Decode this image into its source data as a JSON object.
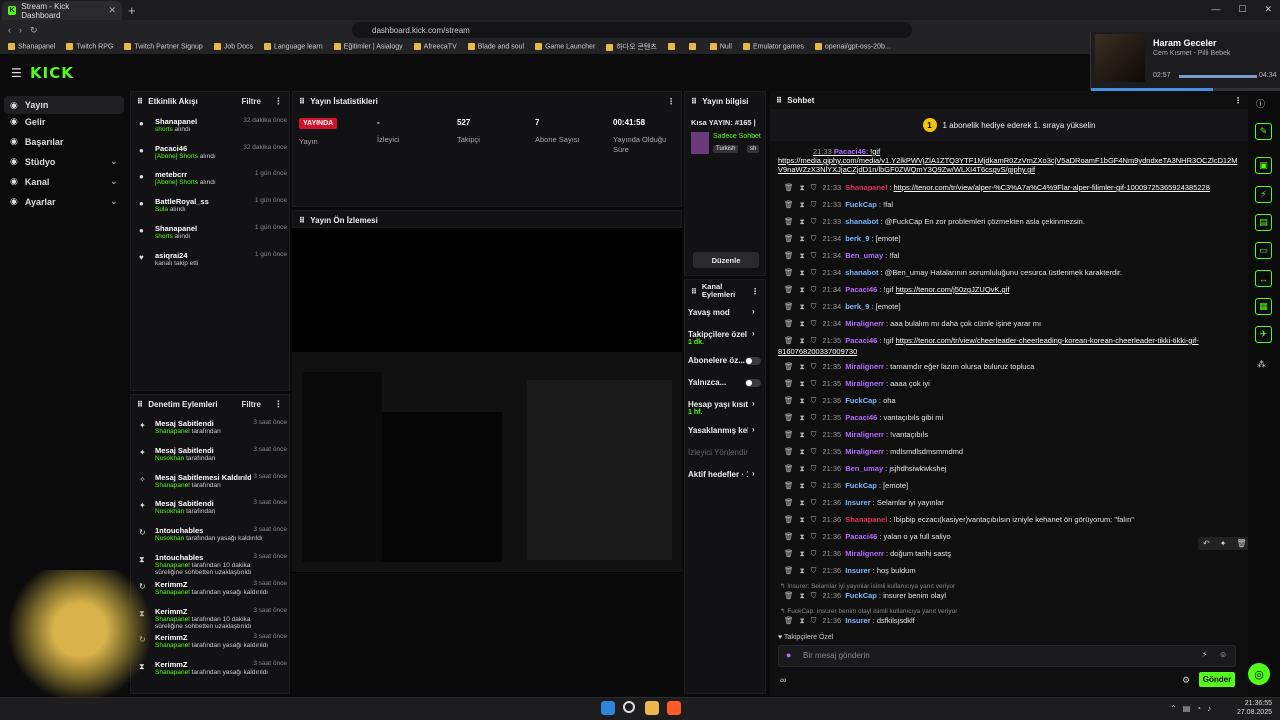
{
  "browser": {
    "tab_title": "Stream - Kick Dashboard",
    "url": "dashboard.kick.com/stream",
    "bookmarks": [
      "Shanapanel",
      "Twitch RPG",
      "Twitch Partner Signup",
      "Job Docs",
      "Language learn",
      "Eğitimler | Asialogy",
      "AfreecaTV",
      "Blade and soul",
      "Game Launcher",
      "하다오 콘텐츠",
      "",
      "",
      "Null",
      "Emulator games",
      "openai/gpt-oss-20b..."
    ]
  },
  "media": {
    "song": "Haram Geceler",
    "artist": "Cem Kısmet - Pilli Bebek",
    "elapsed": "02:57",
    "total": "04:34",
    "progress": 0.64
  },
  "logo": "KICK",
  "nav": [
    {
      "label": "Yayın",
      "active": true,
      "chevron": false
    },
    {
      "label": "Gelir",
      "chevron": false
    },
    {
      "label": "Başarılar",
      "chevron": false
    },
    {
      "label": "Stüdyo",
      "chevron": true
    },
    {
      "label": "Kanal",
      "chevron": true
    },
    {
      "label": "Ayarlar",
      "chevron": true
    }
  ],
  "activity": {
    "title": "Etkinlik Akışı",
    "filter": "Filtre",
    "items": [
      {
        "name": "Shanapanel",
        "sub": "shorts",
        "subtail": "alındı",
        "time": "32 dakika önce",
        "icon": "●"
      },
      {
        "name": "Pacaci46",
        "sub": "[Abone] Shorts",
        "subtail": "alındı",
        "time": "32 dakika önce",
        "icon": "●"
      },
      {
        "name": "metebcrr",
        "sub": "[Abone] Shorts",
        "subtail": "alındı",
        "time": "1 gün önce",
        "icon": "●"
      },
      {
        "name": "BattleRoyal_ss",
        "sub": "Sula",
        "subtail": "alındı",
        "time": "1 gün önce",
        "icon": "●"
      },
      {
        "name": "Shanapanel",
        "sub": "shorts",
        "subtail": "alındı",
        "time": "1 gün önce",
        "icon": "●"
      },
      {
        "name": "asiqrai24",
        "sub": "",
        "subtail": "kanalı takip etti",
        "time": "1 gün önce",
        "icon": "♥"
      }
    ]
  },
  "mod": {
    "title": "Denetim Eylemleri",
    "filter": "Filtre",
    "items": [
      {
        "name": "Mesaj Sabitlendi",
        "by": "Shanapanel",
        "tail": "tarafından",
        "time": "3 saat önce",
        "icon": "✦"
      },
      {
        "name": "Mesaj Sabitlendi",
        "by": "Nusokhan",
        "tail": "tarafından",
        "time": "3 saat önce",
        "icon": "✦"
      },
      {
        "name": "Mesaj Sabitlemesi Kaldırıldı",
        "by": "Shanapanel",
        "tail": "tarafından",
        "time": "3 saat önce",
        "icon": "✧"
      },
      {
        "name": "Mesaj Sabitlendi",
        "by": "Nusokhan",
        "tail": "tarafından",
        "time": "3 saat önce",
        "icon": "✦"
      },
      {
        "name": "1ntouchables",
        "by": "Nusokhan",
        "tail": "tarafından yasağı kaldırıldı",
        "time": "3 saat önce",
        "icon": "↻"
      },
      {
        "name": "1ntouchables",
        "by": "Shanapanel",
        "tail": "tarafından 10 dakika süreliğine sohbetten uzaklaştırıldı",
        "time": "3 saat önce",
        "icon": "⧗"
      },
      {
        "name": "KerimmZ",
        "by": "Shanapanel",
        "tail": "tarafından yasağı kaldırıldı",
        "time": "3 saat önce",
        "icon": "↻"
      },
      {
        "name": "KerimmZ",
        "by": "Shanapanel",
        "tail": "tarafından 10 dakika süreliğine sohbetten uzaklaştırıldı",
        "time": "3 saat önce",
        "icon": "⧗"
      },
      {
        "name": "KerimmZ",
        "by": "Shanapanel",
        "tail": "tarafından yasağı kaldırıldı",
        "time": "3 saat önce",
        "icon": "↻"
      },
      {
        "name": "KerimmZ",
        "by": "Shanapanel",
        "tail": "tarafından yasağı kaldırıldı",
        "time": "3 saat önce",
        "icon": "⧗"
      }
    ]
  },
  "stats": {
    "title": "Yayın İstatistikleri",
    "live": "YAYINDA",
    "live_label": "Yayın",
    "viewers": "-",
    "viewers_label": "İzleyici",
    "followers": "527",
    "followers_label": "Takipçi",
    "subs": "7",
    "subs_label": "Abone Sayısı",
    "uptime": "00:41:58",
    "uptime_label": "Yayında Olduğu Süre"
  },
  "preview": {
    "title": "Yayın Ön İzlemesi"
  },
  "info": {
    "title": "Yayın bilgisi",
    "stream_title": "Kısa YAYIN: #165 |",
    "category": "Sadece Sohbet",
    "tags": [
      "Turkish",
      "sh"
    ],
    "edit": "Düzenle"
  },
  "actions": {
    "title": "Kanal Eylemleri",
    "items": [
      {
        "label": "Yavaş mod",
        "sub": "",
        "ctl": "›"
      },
      {
        "label": "Takipçilere özel so",
        "sub": "1 dk.",
        "ctl": "›"
      },
      {
        "label": "Abonelere öz...",
        "sub": "",
        "ctl": "toggle"
      },
      {
        "label": "Yalnızca...",
        "sub": "",
        "ctl": "toggle"
      },
      {
        "label": "Hesap yaşı kısıtlar",
        "sub": "1 hf.",
        "ctl": "›"
      },
      {
        "label": "Yasaklanmış kelim",
        "sub": "",
        "ctl": "›"
      },
      {
        "label": "İzleyici Yönlendir",
        "sub": "",
        "ctl": ""
      },
      {
        "label": "Aktif hedefler · 1",
        "sub": "",
        "ctl": "›"
      }
    ]
  },
  "chat": {
    "title": "Sohbet",
    "pinned": "1 abonelik hediye ederek 1. sıraya yükselin",
    "pinned_link": "https://media.giphy.com/media/v1.Y2lkPWVjZlA1ZTQ3YTF1MjdkamR0ZzVmZXo3cjV5aDRoamF1bGF4Nm9ydndxeTA3NHR3OCZlcD12MV9naWZzX3NlYXJjaCZjdD1n/",
    "pinned_link2": "lbGF0ZWQmY3Q9Zw/WLXI4T6csgvS/giphy.gif",
    "messages": [
      {
        "time": "21:33",
        "user": "Shanapanel",
        "color": "#e0305a",
        "text": "",
        "link": "https://tenor.com/tr/view/alper-%C3%A7a%C4%9Flar-alper-filimler-gif-10009725365924385228"
      },
      {
        "time": "21:33",
        "user": "FuckCap",
        "color": "#7ab8ff",
        "text": "!fal"
      },
      {
        "time": "21:33",
        "user": "shanabot",
        "color": "#7ab8ff",
        "text": "@FuckCap En zor problemleri çözmekten asla çekinmezsin."
      },
      {
        "time": "21:34",
        "user": "berk_9",
        "color": "#7ab8ff",
        "text": "[emote]"
      },
      {
        "time": "21:34",
        "user": "Ben_umay",
        "color": "#b46bff",
        "text": "!fal"
      },
      {
        "time": "21:34",
        "user": "shanabot",
        "color": "#7ab8ff",
        "text": "@Ben_umay Hatalarının sorumluluğunu cesurca üstlenmek karakterdir."
      },
      {
        "time": "21:34",
        "user": "Pacaci46",
        "color": "#b46bff",
        "text": "!gif",
        "link": "https://tenor.com/j50zgJZUQvK.gif"
      },
      {
        "time": "21:34",
        "user": "berk_9",
        "color": "#7ab8ff",
        "text": "[emote]"
      },
      {
        "time": "21:34",
        "user": "Miralignerr",
        "color": "#b46bff",
        "text": "aaa bulalım mı daha çok cümle işine yarar mı"
      },
      {
        "time": "21:35",
        "user": "Pacaci46",
        "color": "#b46bff",
        "text": "!gif",
        "link": "https://tenor.com/tr/view/cheerleader-cheerleading-korean-korean-cheerleader-tikki-tikki-gif-"
      },
      {
        "time": "",
        "user": "",
        "color": "#fff",
        "text": "",
        "link": "8160768200337009730"
      },
      {
        "time": "21:35",
        "user": "Miralignerr",
        "color": "#b46bff",
        "text": "tamamdır eğer lazım olursa buluruz topluca"
      },
      {
        "time": "21:35",
        "user": "Miralignerr",
        "color": "#b46bff",
        "text": "aaaa çok iyi"
      },
      {
        "time": "21:35",
        "user": "FuckCap",
        "color": "#7ab8ff",
        "text": "oha"
      },
      {
        "time": "21:35",
        "user": "Pacaci46",
        "color": "#b46bff",
        "text": "vantaçıbıls gibi mi"
      },
      {
        "time": "21:35",
        "user": "Miralignerr",
        "color": "#b46bff",
        "text": "!vantaçıbıls"
      },
      {
        "time": "21:35",
        "user": "Miralignerr",
        "color": "#b46bff",
        "text": "mdlsmdlsdmsmmdmd"
      },
      {
        "time": "21:36",
        "user": "Ben_umay",
        "color": "#b46bff",
        "text": "jsjhdhsiwkwkshej"
      },
      {
        "time": "21:36",
        "user": "FuckCap",
        "color": "#7ab8ff",
        "text": "[emote]"
      },
      {
        "time": "21:36",
        "user": "Insurer",
        "color": "#7ab8ff",
        "text": "Selamlar iyi yayınlar"
      },
      {
        "time": "21:36",
        "user": "Shanapanel",
        "color": "#e0305a",
        "text": "!bipbip eczacı(kasiyer)vantaçıbılsın izniyle kehanet ön görüyorum: \"falın\""
      },
      {
        "time": "21:36",
        "user": "Pacaci46",
        "color": "#b46bff",
        "text": "yalan o ya full saliyo"
      },
      {
        "time": "21:36",
        "user": "Miralignerr",
        "color": "#b46bff",
        "text": "doğum tarihi sastş"
      },
      {
        "time": "21:36",
        "user": "Insurer",
        "color": "#7ab8ff",
        "text": "hoş buldum"
      }
    ],
    "reply1": "↰ Insurer: Selamlar iyi yayınlar isimli kullanıcıya yanıt veriyor",
    "msg_reply1": {
      "time": "21:36",
      "user": "FuckCap",
      "color": "#7ab8ff",
      "text": "insurer benim olayl"
    },
    "reply2": "↰ FuckCap: insurer benim olayl isimli kullanıcıya yanıt veriyor",
    "msg_reply2": {
      "time": "21:36",
      "user": "Insurer",
      "color": "#7ab8ff",
      "text": "dsfkilsjsdklf"
    },
    "followers_only": "♥ Takipçilere Özel",
    "placeholder": "Bir mesaj gönderin",
    "send": "Gönder"
  },
  "clock": {
    "time": "21:36:55",
    "date": "27.08.2025"
  },
  "colors": {
    "accent": "#53fc18",
    "live": "#d1122a"
  }
}
